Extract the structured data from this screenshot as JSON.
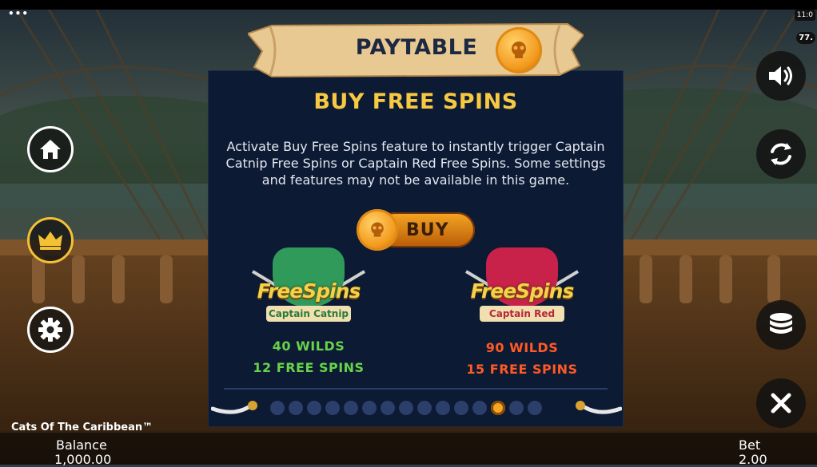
{
  "status": {
    "menu_dots": "•••",
    "clock": "11:0",
    "rtp": "77.",
    "game_name": "Cats Of The Caribbean™"
  },
  "panel": {
    "title": "PAYTABLE",
    "heading": "BUY FREE SPINS",
    "description": "Activate Buy Free Spins feature to instantly trigger Captain Catnip Free Spins or Captain Red Free Spins. Some settings and features may not be available in this game.",
    "buy_label": "BUY",
    "features": [
      {
        "logo": "FreeSpins",
        "subtitle": "Captain Catnip",
        "wilds": "40 WILDS",
        "spins": "12 FREE SPINS",
        "color": "#68d24a"
      },
      {
        "logo": "FreeSpins",
        "subtitle": "Captain Red",
        "wilds": "90 WILDS",
        "spins": "15 FREE SPINS",
        "color": "#ff5a25"
      }
    ],
    "page_count": 15,
    "active_page": 12
  },
  "footer": {
    "balance_label": "Balance",
    "balance_value": "1,000.00",
    "bet_label": "Bet",
    "bet_value": "2.00"
  },
  "icons": {
    "home": "home-icon",
    "crown": "crown-icon",
    "settings": "gear-icon",
    "sound": "speaker-icon",
    "autoplay": "refresh-icon",
    "coins": "coin-stack-icon",
    "close": "close-icon"
  },
  "colors": {
    "panel_bg": "#0c1a33",
    "heading": "#f7c842",
    "accent": "#f5a623"
  }
}
